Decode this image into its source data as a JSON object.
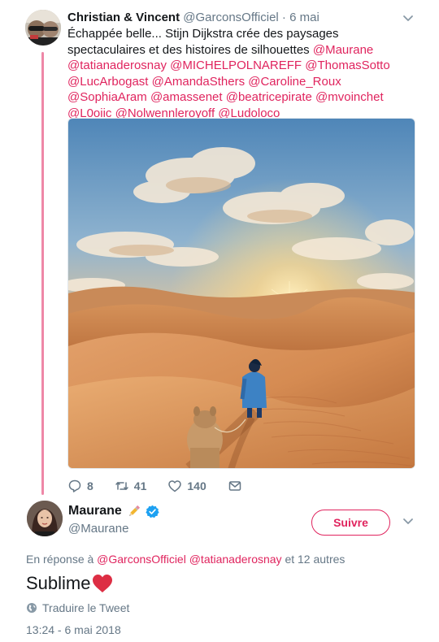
{
  "parent_tweet": {
    "author_name": "Christian & Vincent",
    "author_handle": "@GarconsOfficiel",
    "separator": " · ",
    "date": "6 mai",
    "text_line1": "Échappée belle... Stijn Dijkstra crée des paysages",
    "text_line2": "spectaculaires et des histoires de silhouettes ",
    "mentions": {
      "m1": "@Maurane",
      "m2": "@tatianaderosnay",
      "m3": "@MICHELPOLNAREFF",
      "m4": "@ThomasSotto",
      "m5": "@LucArbogast",
      "m6": "@AmandaSthers",
      "m7": "@Caroline_Roux",
      "m8": "@SophiaAram",
      "m9": "@amassenet",
      "m10": "@beatricepirate",
      "m11": "@mvoinchet",
      "m12": "@L0oiic",
      "m13": "@Nolwennleroyoff",
      "m14": "@Ludoloco"
    },
    "counts": {
      "replies": "8",
      "retweets": "41",
      "likes": "140"
    },
    "icons": {
      "reply": "reply-icon",
      "retweet": "retweet-icon",
      "like": "heart-outline-icon",
      "dm": "envelope-icon",
      "more": "chevron-down-icon"
    }
  },
  "reply_tweet": {
    "author_name": "Maurane",
    "author_handle": "@Maurane",
    "follow_label": "Suivre",
    "reply_prefix": "En réponse à ",
    "reply_to1": "@GarconsOfficiel",
    "reply_to2": "@tatianaderosnay",
    "reply_suffix": " et 12 autres",
    "text": "Sublime",
    "translate_label": "Traduire le Tweet",
    "timestamp": "13:24 - 6 mai 2018",
    "icons": {
      "pencil": "pencil-emoji-icon",
      "verified": "verified-badge-icon",
      "heart": "red-heart-emoji-icon",
      "globe": "globe-icon",
      "more": "chevron-down-icon"
    }
  },
  "colors": {
    "accent": "#e0245e",
    "text": "#14171a",
    "secondary": "#657786",
    "verified": "#1da1f2",
    "heart": "#e0245e"
  }
}
